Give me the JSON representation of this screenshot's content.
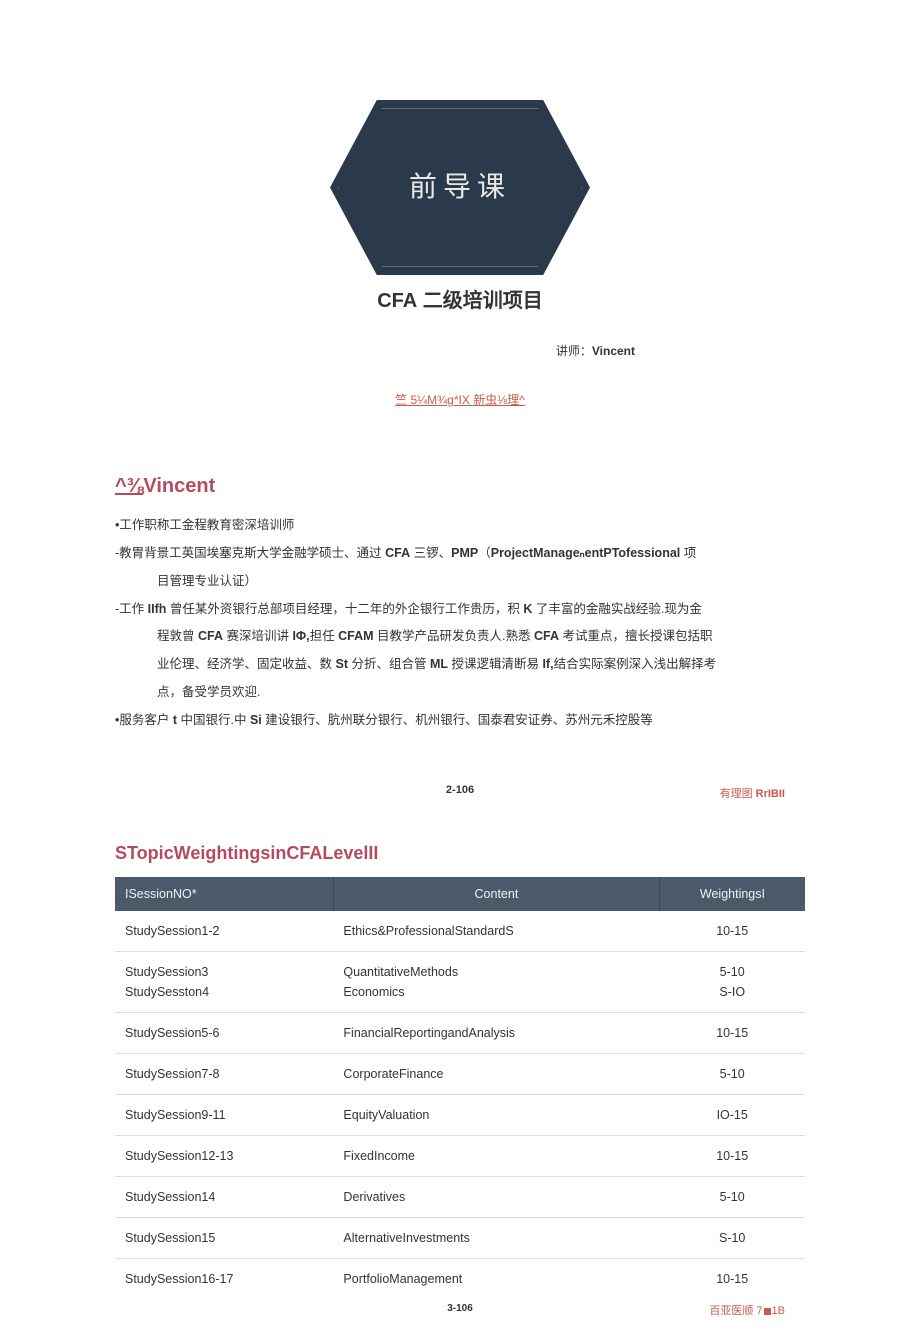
{
  "hero": {
    "hex_text": "前导课",
    "title_prefix": "CFA",
    "title_rest": " 二级培训项目",
    "instructor_label": "讲师：",
    "instructor_name": "Vincent",
    "weird_link": "竺 5¼M¾g*IX 新虫⅛理^"
  },
  "bio": {
    "heading_prefix": "^⅜",
    "heading_name": "Vincent",
    "line1_pre": "•工作职称工金程教育密深培训师",
    "line2_pre": "-教胃背景工英国埃塞克斯大学金融学硕士、通过 ",
    "line2_b1": "CFA",
    "line2_mid1": " 三锣、",
    "line2_b2": "PMP",
    "line2_mid2": "（",
    "line2_b3": "ProjectManageₙentPTofessional",
    "line2_tail": " 项",
    "line2_indent": "目管理专业认证）",
    "line3_pre": "-工作 ",
    "line3_b1": "IIfh",
    "line3_mid1": " 曾任某外资银行总部项目经理，十二年的外企银行工作贵历，积 ",
    "line3_b2": "K",
    "line3_tail": " 了丰富的金融实战经验.现为金",
    "line3i1_pre": "程敦曾 ",
    "line3i1_b1": "CFA",
    "line3i1_mid1": " 赛深培训讲 ",
    "line3i1_b2": "IΦ,",
    "line3i1_mid2": "担任 ",
    "line3i1_b3": "CFAM",
    "line3i1_mid3": " 目教学产品研发负责人.熟悉 ",
    "line3i1_b4": "CFA",
    "line3i1_tail": " 考试重点，擅长授课包括职",
    "line3i2_pre": "业伦理、经济学、固定收益、数 ",
    "line3i2_b1": "St",
    "line3i2_mid1": " 分折、组合管 ",
    "line3i2_b2": "ML",
    "line3i2_mid2": " 授课逻辑清断易 ",
    "line3i2_b3": "If,",
    "line3i2_tail": "结合实际案例深入浅出解择考",
    "line3i3": "点，备受学员欢迎.",
    "line4_pre": "•服务客户 ",
    "line4_b1": "t",
    "line4_mid1": " 中国银行.中 ",
    "line4_b2": "Si",
    "line4_tail": " 建设银行、肮州联分银行、机州银行、国泰君安证券、苏州元禾控股等",
    "page_num": "2-106",
    "badge_pre": "有理图 ",
    "badge_b": "RrIBII"
  },
  "topics": {
    "heading": "STopicWeightingsinCFALevelII",
    "headers": {
      "c1": "ISessionNO*",
      "c2": "Content",
      "c3": "WeightingsI"
    },
    "rows": [
      {
        "s": "StudySession1-2",
        "c": "Ethics&ProfessionalStandardS",
        "w": "10-15"
      },
      {
        "s": "StudySession3\nStudySesston4",
        "c": "QuantitativeMethods\nEconomics",
        "w": "5-10\nS-IO"
      },
      {
        "s": "StudySession5-6",
        "c": "FinancialReportingandAnalysis",
        "w": "10-15"
      },
      {
        "s": "StudySession7-8",
        "c": "CorporateFinance",
        "w": "5-10"
      },
      {
        "s": "StudySession9-11",
        "c": "EquityValuation",
        "w": "IO-15"
      },
      {
        "s": "StudySession12-13",
        "c": "FixedIncome",
        "w": "10-15"
      },
      {
        "s": "StudySession14",
        "c": "Derivatives",
        "w": "5-10"
      },
      {
        "s": "StudySession15",
        "c": "AlternativeInvestments",
        "w": "S-10"
      },
      {
        "s": "StudySession16-17",
        "c": "PortfolioManagement",
        "w": "10-15"
      }
    ],
    "inner_num": "3-106",
    "badge2_pre": "百亚医顺 7",
    "badge2_tail": "1B"
  }
}
